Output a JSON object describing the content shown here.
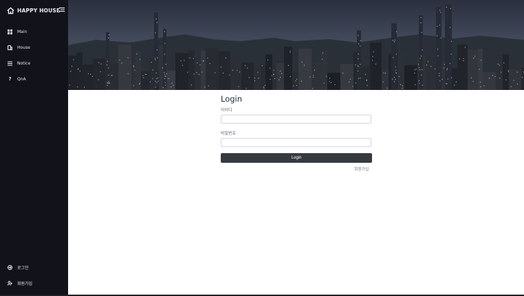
{
  "app": {
    "title": "HAPPY HOUSE"
  },
  "sidebar": {
    "items": [
      {
        "label": "Main",
        "icon": "grid-icon"
      },
      {
        "label": "House",
        "icon": "building-icon"
      },
      {
        "label": "Notice",
        "icon": "list-icon"
      },
      {
        "label": "QnA",
        "icon": "question-icon"
      }
    ],
    "footer_items": [
      {
        "label": "로그인",
        "icon": "login-icon"
      },
      {
        "label": "회원가입",
        "icon": "user-plus-icon"
      }
    ]
  },
  "login": {
    "title": "Login",
    "id_label": "아이디",
    "id_value": "",
    "password_label": "비밀번호",
    "password_value": "",
    "button_label": "Login",
    "signup_link": "회원가입"
  },
  "colors": {
    "sidebar_bg": "#12121b",
    "button_bg": "#343a40",
    "title_text": "#22303f"
  }
}
